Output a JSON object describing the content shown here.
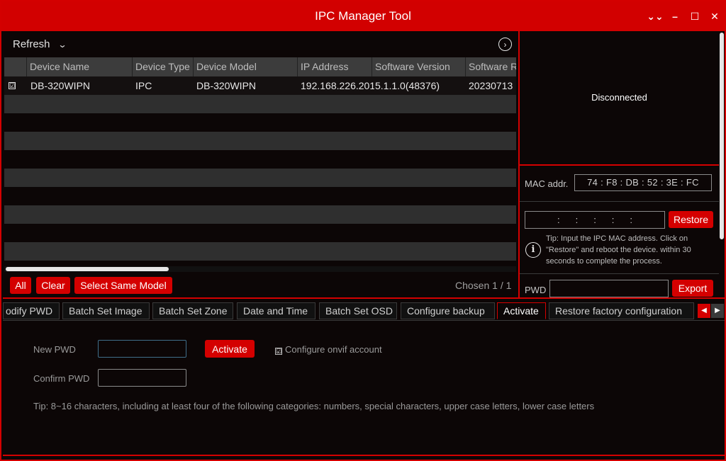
{
  "window": {
    "title": "IPC Manager Tool",
    "controls": {
      "collapse": "⌄⌄",
      "minimize": "–",
      "maximize": "☐",
      "close": "✕"
    }
  },
  "devices": {
    "refresh_label": "Refresh",
    "columns": [
      "Device Name",
      "Device Type",
      "Device Model",
      "IP Address",
      "Software Version",
      "Software Re"
    ],
    "rows": [
      {
        "checked": "☑",
        "name": "DB-320WIPN",
        "type": "IPC",
        "model": "DB-320WIPN",
        "ip": "192.168.226.201",
        "version": "5.1.1.0(48376)",
        "release": "20230713"
      }
    ],
    "buttons": {
      "all": "All",
      "clear": "Clear",
      "select_same_model": "Select Same Model"
    },
    "chosen": "Chosen  1 / 1"
  },
  "right": {
    "status": "Disconnected",
    "mac_label": "MAC addr.",
    "mac_value": "74 : F8 : DB : 52 : 3E : FC",
    "mac_input": ":::::",
    "restore_label": "Restore",
    "tip": "Tip: Input the IPC MAC address. Click on \"Restore\" and reboot the device. within 30 seconds to complete the process.",
    "pwd_label": "PWD",
    "export_label": "Export"
  },
  "tabs": [
    "odify PWD",
    "Batch Set Image",
    "Batch Set Zone",
    "Date and Time",
    "Batch Set OSD",
    "Configure backup",
    "Activate",
    "Restore factory configuration"
  ],
  "active_tab": "Activate",
  "activate": {
    "new_pwd_label": "New PWD",
    "confirm_pwd_label": "Confirm PWD",
    "activate_button": "Activate",
    "onvif_check": "☑",
    "onvif_label": "Configure onvif account",
    "tip": "Tip: 8~16 characters, including at least four of the following categories: numbers, special characters, upper case letters, lower case letters"
  },
  "colors": {
    "accent": "#d40000",
    "background": "#0c0606",
    "row_alt": "#2f2f2f"
  }
}
